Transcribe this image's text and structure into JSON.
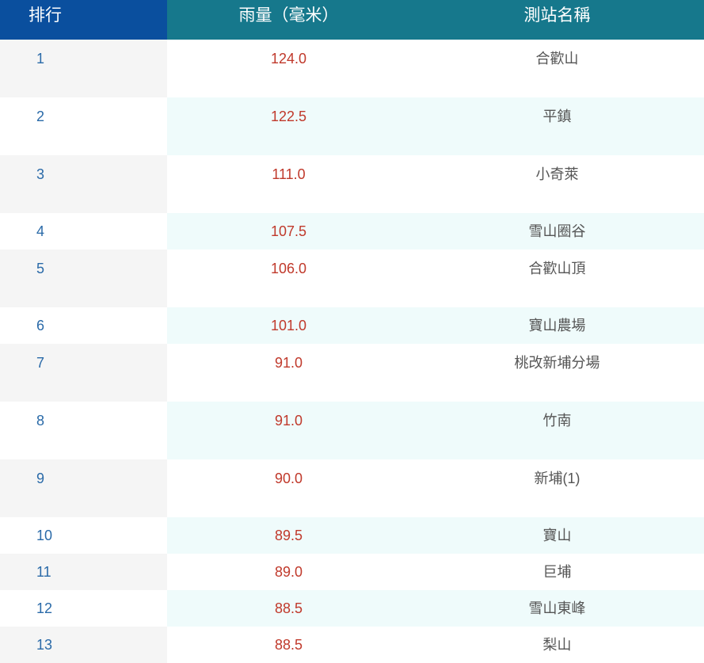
{
  "table": {
    "headers": {
      "rank": "排行",
      "rain": "雨量（毫米）",
      "station": "測站名稱"
    },
    "rows": [
      {
        "rank": "1",
        "rain": "124.0",
        "station": "合歡山"
      },
      {
        "rank": "2",
        "rain": "122.5",
        "station": "平鎮"
      },
      {
        "rank": "3",
        "rain": "111.0",
        "station": "小奇萊"
      },
      {
        "rank": "4",
        "rain": "107.5",
        "station": "雪山圈谷"
      },
      {
        "rank": "5",
        "rain": "106.0",
        "station": "合歡山頂"
      },
      {
        "rank": "6",
        "rain": "101.0",
        "station": "寶山農場"
      },
      {
        "rank": "7",
        "rain": "91.0",
        "station": "桃改新埔分場"
      },
      {
        "rank": "8",
        "rain": "91.0",
        "station": "竹南"
      },
      {
        "rank": "9",
        "rain": "90.0",
        "station": "新埔(1)"
      },
      {
        "rank": "10",
        "rain": "89.5",
        "station": "寶山"
      },
      {
        "rank": "11",
        "rain": "89.0",
        "station": "巨埔"
      },
      {
        "rank": "12",
        "rain": "88.5",
        "station": "雪山東峰"
      },
      {
        "rank": "13",
        "rain": "88.5",
        "station": "梨山"
      }
    ]
  },
  "colors": {
    "header_rank_bg": "#0a4f9e",
    "header_bg": "#16788c",
    "rank_text": "#2a6aa8",
    "rain_text": "#c0392b",
    "station_text": "#555555",
    "alt_row_bg": "#effbfb"
  }
}
